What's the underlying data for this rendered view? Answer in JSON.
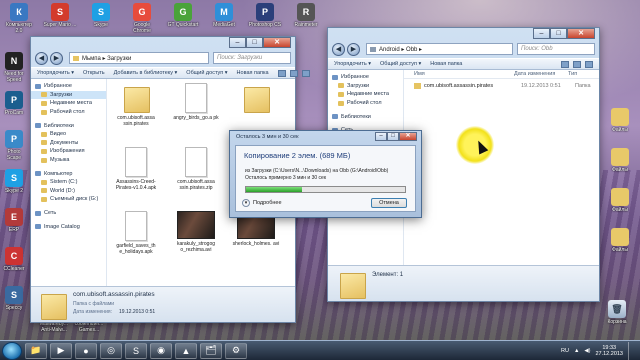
{
  "desktop": {
    "icons_top": [
      {
        "label": "Компьютер 2.0",
        "color": "#3a78c2",
        "glyph": "monitor-icon"
      },
      {
        "label": "Super Mario ...",
        "color": "#d33b2c",
        "glyph": "mushroom-icon"
      },
      {
        "label": "Skype",
        "color": "#1fa0e4",
        "glyph": "skype-icon"
      },
      {
        "label": "Google Chrome",
        "color": "#e74c3c",
        "glyph": "chrome-icon"
      },
      {
        "label": "GT Quickstart",
        "color": "#4aa33a",
        "glyph": "app-icon"
      },
      {
        "label": "MediaGet",
        "color": "#2f8fd8",
        "glyph": "app-icon"
      },
      {
        "label": "Photoshop CS",
        "color": "#2b3f7a",
        "glyph": "ps-icon"
      },
      {
        "label": "Rainmeter",
        "color": "#555555",
        "glyph": "app-icon"
      }
    ],
    "icons_left": [
      {
        "label": "Need for Speed",
        "color": "#222222"
      },
      {
        "label": "ProCam",
        "color": "#1b5e8f"
      },
      {
        "label": "Photo Scape",
        "color": "#3a8ac9"
      },
      {
        "label": "Skype 2",
        "color": "#1fa0e4"
      },
      {
        "label": "ERP",
        "color": "#b33a3a"
      },
      {
        "label": "CCleaner",
        "color": "#cc3333"
      },
      {
        "label": "Speccy",
        "color": "#3a6aa0"
      }
    ],
    "icons_right": [
      {
        "label": "Файлы",
        "color": "#e8c969"
      },
      {
        "label": "Файлы",
        "color": "#e8c969"
      },
      {
        "label": "Файлы",
        "color": "#e8c969"
      },
      {
        "label": "Файлы",
        "color": "#e8c969"
      }
    ],
    "trash_label": "Корзина",
    "bottom_left_icons": [
      {
        "label": "Malwareby... Anti-Malw..."
      },
      {
        "label": "coolemuter... Games..."
      }
    ]
  },
  "win_left": {
    "address": "Мьмпа ▸ Загрузки",
    "search_placeholder": "Поиск: Загрузки",
    "toolbar": [
      "Упорядочить ▾",
      "Открыть",
      "Добавить в библиотеку ▾",
      "Общий доступ ▾",
      "Новая папка"
    ],
    "sidebar": [
      {
        "label": "Избранное",
        "head": true
      },
      {
        "label": "Загрузки",
        "sel": true
      },
      {
        "label": "Недавние места"
      },
      {
        "label": "Рабочий стол"
      },
      {
        "label": "Библиотеки",
        "head": true,
        "gap": true
      },
      {
        "label": "Видео"
      },
      {
        "label": "Документы"
      },
      {
        "label": "Изображения"
      },
      {
        "label": "Музыка"
      },
      {
        "label": "Компьютер",
        "head": true,
        "gap": true
      },
      {
        "label": "Sistem (C:)"
      },
      {
        "label": "World (D:)"
      },
      {
        "label": "Съемный диск (G:)"
      },
      {
        "label": "Сеть",
        "head": true,
        "gap": true
      },
      {
        "label": "Image Catalog",
        "head": true,
        "gap": true
      }
    ],
    "files": [
      {
        "label": "com.ubisoft.assa ssin.pirates",
        "kind": "folder"
      },
      {
        "label": "angry_birds_go.a pk",
        "kind": "doc"
      },
      {
        "label": "",
        "kind": "folder"
      },
      {
        "label": "Assassins-Creed- Pirates-v1.0.4.apk",
        "kind": "doc"
      },
      {
        "label": "com.ubisoft.assa ssin.pirates.zip",
        "kind": "doc"
      },
      {
        "label": "",
        "kind": "folder"
      },
      {
        "label": "garfield_saves_th e_holidays.apk",
        "kind": "doc"
      },
      {
        "label": "karakuly_strogog o_rezhima.avi",
        "kind": "video"
      },
      {
        "label": "sherlock_holmes. avi",
        "kind": "video"
      }
    ],
    "status_name": "com.ubisoft.assassin.pirates",
    "status_type": "Папка с файлами",
    "status_date_label": "Дата изменения:",
    "status_date": "19.12.2013 0:51"
  },
  "win_right": {
    "address": "Android ▸ Obb ▸",
    "search_placeholder": "Поиск: Obb",
    "toolbar": [
      "Упорядочить ▾",
      "Общий доступ ▾",
      "Новая папка"
    ],
    "sidebar": [
      {
        "label": "Избранное",
        "head": true
      },
      {
        "label": "Загрузки"
      },
      {
        "label": "Недавние места"
      },
      {
        "label": "Рабочий стол"
      },
      {
        "label": "Библиотеки",
        "head": true,
        "gap": true
      },
      {
        "label": "Сеть",
        "head": true,
        "gap": true
      },
      {
        "label": "Image Catalog",
        "head": true,
        "gap": true
      }
    ],
    "col_name": "Имя",
    "col_date": "Дата изменения",
    "col_type": "Тип",
    "row_name": "com.ubisoft.assassin.pirates",
    "row_date": "19.12.2013 0:51",
    "row_type": "Папка",
    "status_text": "Элемент: 1"
  },
  "dialog": {
    "title": "Осталось 3 мин и 30 сек",
    "heading": "Копирование 2 элем. (689 МБ)",
    "line1": "из Загрузки (C:\\Users\\N...\\Downloads) на Obb (G:\\Android\\Obb)",
    "line2": "Осталось примерно 3 мин и 30 сек",
    "progress": 0.35,
    "details_label": "Подробнее",
    "cancel_label": "Отмена"
  },
  "taskbar": {
    "apps": [
      "folder-icon",
      "media-player-icon",
      "play-icon",
      "chrome-icon",
      "skype-icon",
      "camtasia-icon",
      "pdf-icon",
      "explorer-icon",
      "settings-icon"
    ],
    "lang": "RU",
    "time": "19:33",
    "date": "27.12.2013"
  }
}
